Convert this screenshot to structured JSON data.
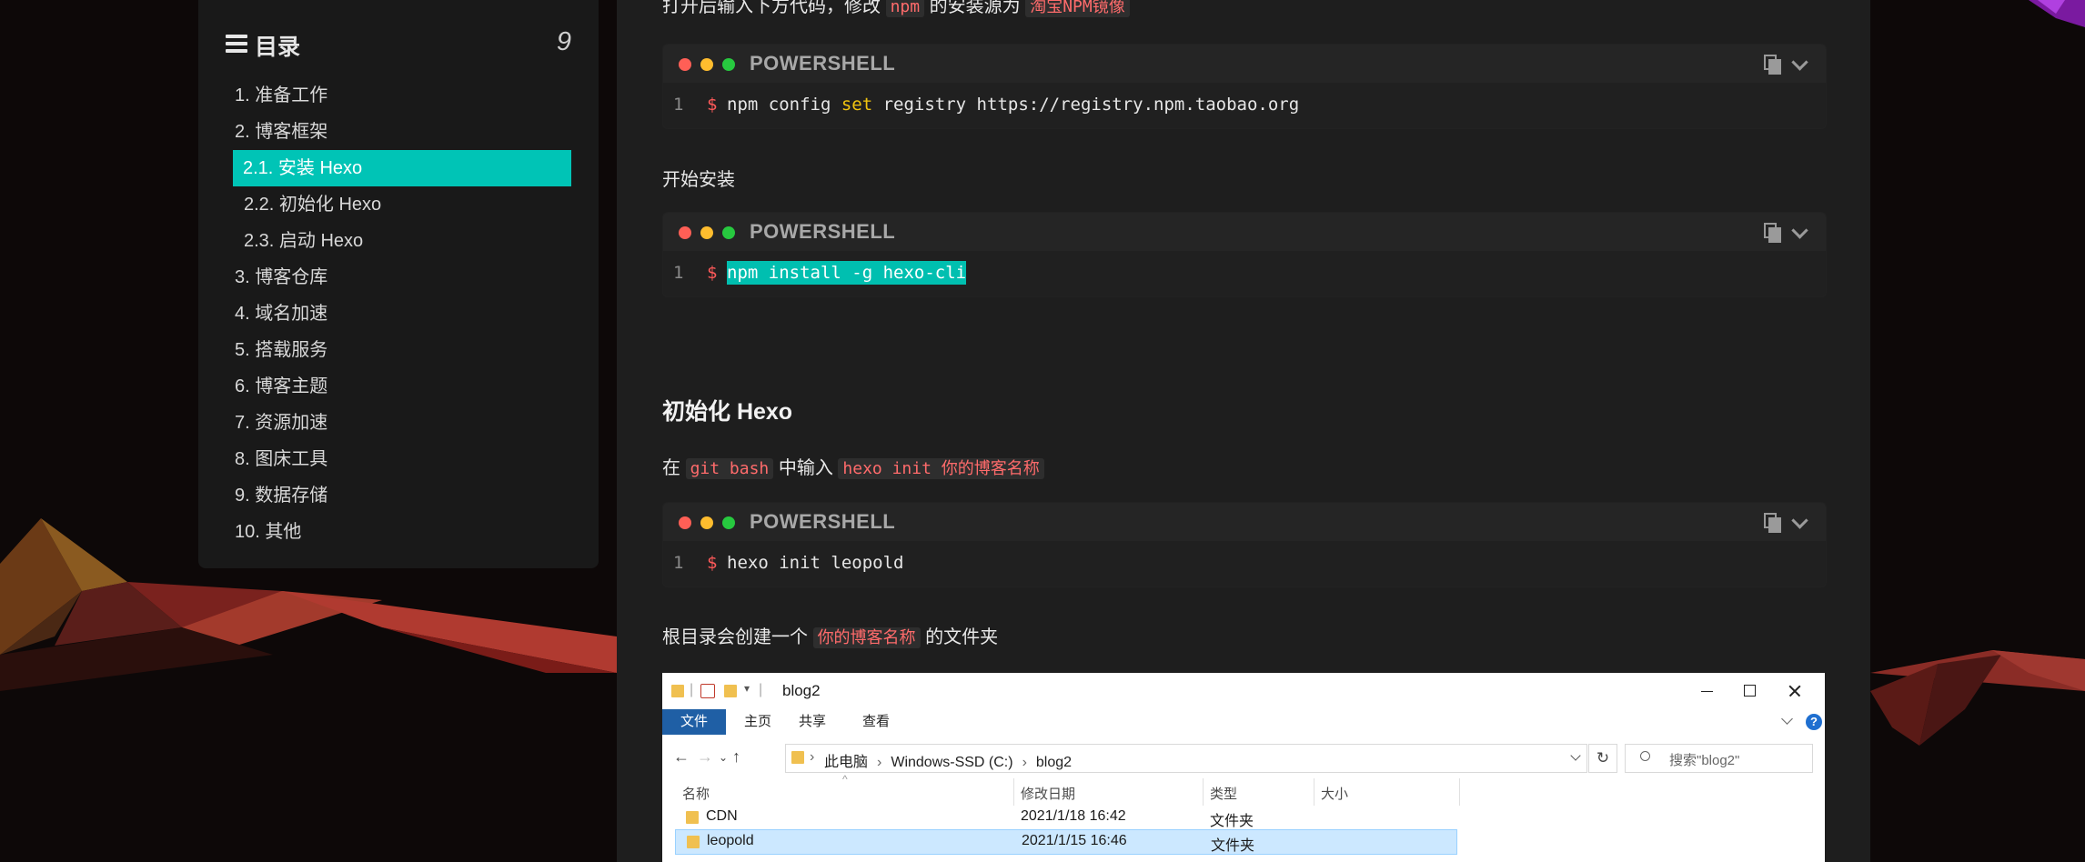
{
  "toc": {
    "title": "目录",
    "count": "9",
    "items": [
      {
        "label": "1. 准备工作"
      },
      {
        "label": "2. 博客框架"
      },
      {
        "label": "2.1. 安装 Hexo"
      },
      {
        "label": "2.2. 初始化 Hexo"
      },
      {
        "label": "2.3. 启动 Hexo"
      },
      {
        "label": "3. 博客仓库"
      },
      {
        "label": "4. 域名加速"
      },
      {
        "label": "5. 搭载服务"
      },
      {
        "label": "6. 博客主题"
      },
      {
        "label": "7. 资源加速"
      },
      {
        "label": "8. 图床工具"
      },
      {
        "label": "9. 数据存储"
      },
      {
        "label": "10. 其他"
      }
    ],
    "active_label": "2.1. 安装 Hexo"
  },
  "article": {
    "p1": {
      "prefix": "打开后输入下方代码，修改",
      "code1": "npm",
      "middle": "的安装源为",
      "code2": "淘宝NPM镜像"
    },
    "code1": {
      "lang": "POWERSHELL",
      "line": "1",
      "prompt": "$",
      "cmd_pre": "npm config ",
      "cmd_kw": "set",
      "cmd_post": " registry https://registry.npm.taobao.org"
    },
    "p2": "开始安装",
    "code2": {
      "lang": "POWERSHELL",
      "line": "1",
      "prompt": "$",
      "cmd": "npm install -g hexo-cli"
    },
    "heading": "初始化 Hexo",
    "p3": {
      "prefix": "在",
      "code1": "git bash",
      "middle": "中输入",
      "code2": "hexo init 你的博客名称"
    },
    "code3": {
      "lang": "POWERSHELL",
      "line": "1",
      "prompt": "$",
      "cmd": "hexo init leopold"
    },
    "p4": {
      "prefix": "根目录会创建一个",
      "code1": "你的博客名称",
      "suffix": "的文件夹"
    }
  },
  "explorer": {
    "title": "blog2",
    "tabs": [
      "文件",
      "主页",
      "共享",
      "查看"
    ],
    "breadcrumbs": [
      "此电脑",
      "Windows-SSD (C:)",
      "blog2"
    ],
    "search_placeholder": "搜索\"blog2\"",
    "columns": [
      "名称",
      "修改日期",
      "类型",
      "大小"
    ],
    "rows": [
      {
        "name": "CDN",
        "date": "2021/1/18 16:42",
        "type": "文件夹",
        "selected": false
      },
      {
        "name": "leopold",
        "date": "2021/1/15 16:46",
        "type": "文件夹",
        "selected": true
      }
    ]
  },
  "colors": {
    "accent": "#00c4b6",
    "code_red": "#ff6b6b",
    "prompt_red": "#ff5a5a",
    "keyword": "#f1c40f"
  }
}
